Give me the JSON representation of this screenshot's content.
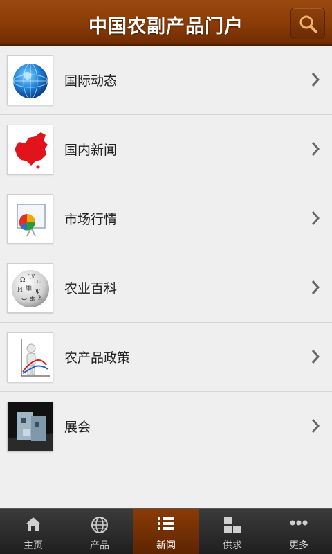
{
  "header": {
    "title": "中国农副产品门户",
    "search_icon": "search-icon"
  },
  "list": {
    "items": [
      {
        "label": "国际动态",
        "icon": "globe-icon"
      },
      {
        "label": "国内新闻",
        "icon": "china-map-icon"
      },
      {
        "label": "市场行情",
        "icon": "pie-chart-board-icon"
      },
      {
        "label": "农业百科",
        "icon": "wikipedia-globe-icon"
      },
      {
        "label": "农产品政策",
        "icon": "person-chart-icon"
      },
      {
        "label": "展会",
        "icon": "exhibition-photo-icon"
      }
    ],
    "chevron_icon": "chevron-right-icon"
  },
  "tabbar": {
    "tabs": [
      {
        "label": "主页",
        "icon": "home-icon",
        "active": false
      },
      {
        "label": "产品",
        "icon": "globe-outline-icon",
        "active": false
      },
      {
        "label": "新闻",
        "icon": "list-icon",
        "active": true
      },
      {
        "label": "供求",
        "icon": "grid-icon",
        "active": false
      },
      {
        "label": "更多",
        "icon": "more-dots-icon",
        "active": false
      }
    ]
  },
  "colors": {
    "header_brown": "#8a3b06",
    "active_tab": "#8a3b06",
    "tabbar_bg": "#2a2a2a",
    "list_bg": "#efefef"
  }
}
